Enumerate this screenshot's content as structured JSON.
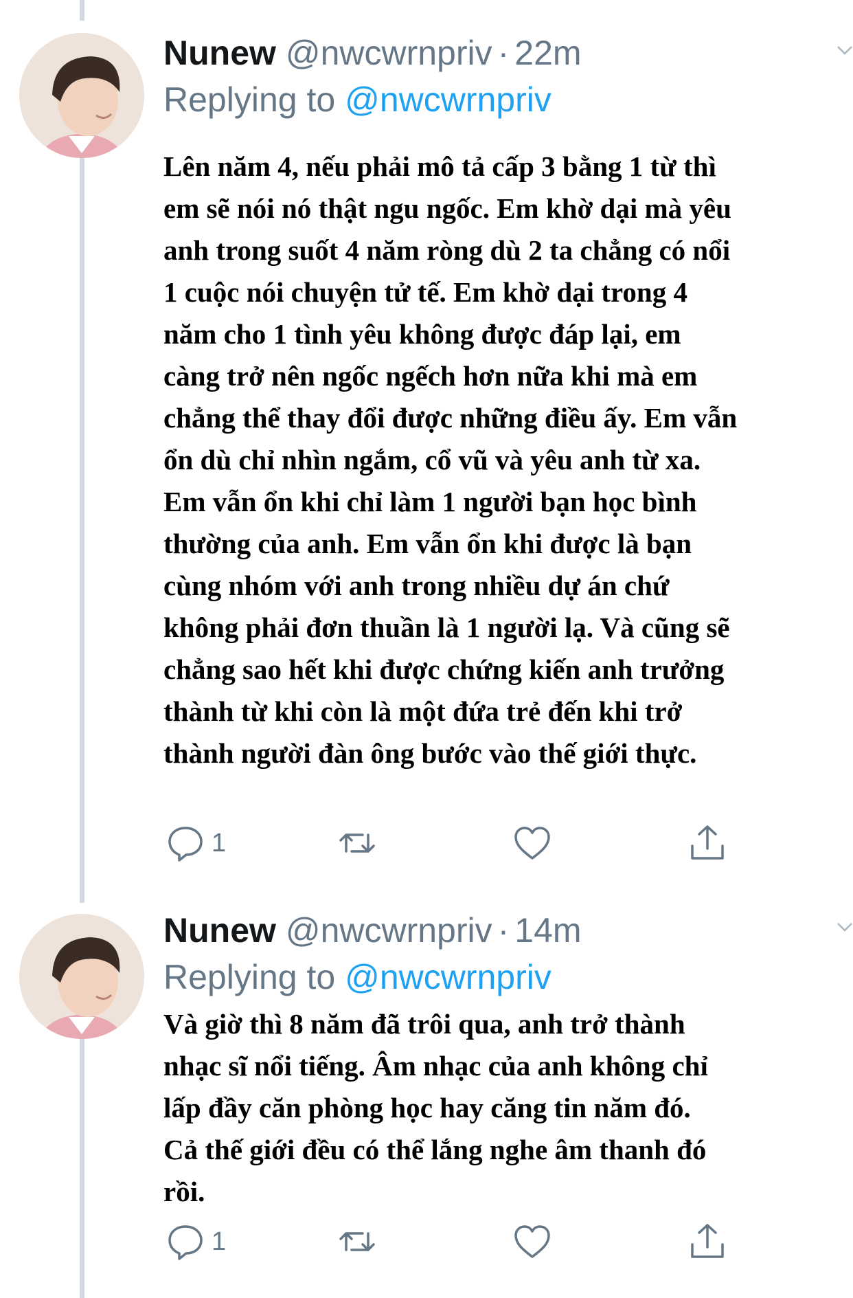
{
  "tweets": [
    {
      "name": "Nunew",
      "handle": "@nwcwrnpriv",
      "separator": "·",
      "time": "22m",
      "replying_prefix": "Replying to",
      "replying_to": "@nwcwrnpriv",
      "text": "Lên năm 4, nếu phải mô tả cấp 3 bằng 1 từ thì\nem sẽ nói nó thật ngu ngốc. Em khờ dại mà yêu\nanh trong suốt 4 năm ròng dù 2 ta chẳng có nổi\n1 cuộc nói chuyện tử tế. Em khờ dại trong 4\nnăm cho 1 tình yêu không được đáp lại, em\ncàng trở nên ngốc ngếch hơn nữa khi mà em\nchẳng thể thay đổi được những điều ấy. Em vẫn\nổn dù chỉ nhìn ngắm, cổ vũ và yêu anh từ xa.\nEm vẫn ổn khi chỉ làm 1 người bạn học bình\nthường của anh. Em vẫn ổn khi được là bạn\ncùng nhóm với anh trong nhiều dự án chứ\nkhông phải đơn thuần là 1 người lạ. Và cũng sẽ\nchẳng sao hết khi được chứng kiến anh trưởng\nthành từ khi còn là một đứa trẻ đến khi trở\nthành người đàn ông bước vào thế giới thực.",
      "reply_count": "1"
    },
    {
      "name": "Nunew",
      "handle": "@nwcwrnpriv",
      "separator": "·",
      "time": "14m",
      "replying_prefix": "Replying to",
      "replying_to": "@nwcwrnpriv",
      "text": "Và giờ thì 8 năm đã trôi qua, anh trở thành\nnhạc sĩ nổi tiếng. Âm nhạc của anh không chỉ\nlấp đầy căn phòng học hay căng tin năm đó.\nCả thế giới đều có thể lắng nghe âm thanh đó\nrồi.",
      "reply_count": "1"
    }
  ],
  "icons": [
    "reply-icon",
    "retweet-icon",
    "like-icon",
    "share-icon",
    "chevron-down-icon"
  ],
  "colors": {
    "name": "#14171a",
    "secondary": "#657786",
    "mention": "#1da1f2",
    "thread_line": "#d3d9de"
  }
}
